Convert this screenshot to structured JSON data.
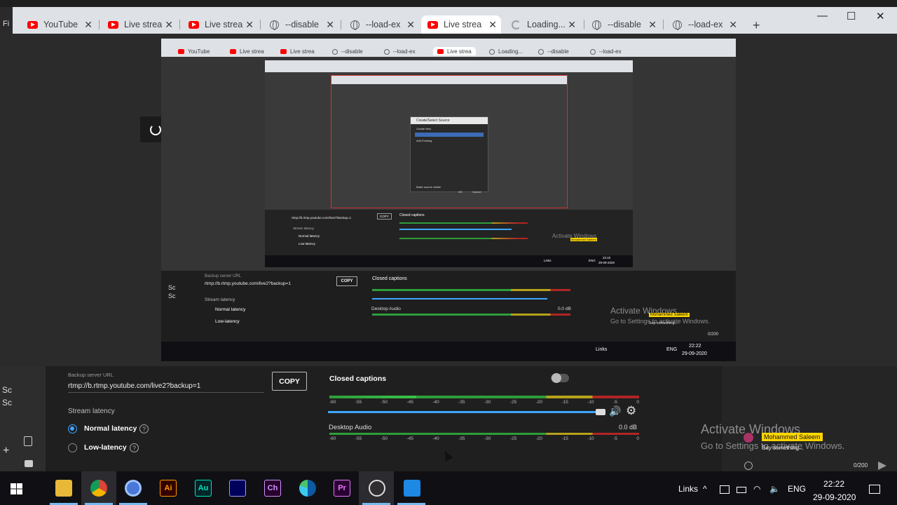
{
  "browser": {
    "side_label": "Fi",
    "tabs": [
      {
        "label": "YouTube",
        "icon": "youtube-icon"
      },
      {
        "label": "Live strea",
        "icon": "youtube-icon"
      },
      {
        "label": "Live strea",
        "icon": "youtube-icon"
      },
      {
        "label": "--disable",
        "icon": "globe-icon"
      },
      {
        "label": "--load-ex",
        "icon": "globe-icon"
      },
      {
        "label": "Live strea",
        "icon": "youtube-icon",
        "active": true
      },
      {
        "label": "Loading...",
        "icon": "loading-spinner-icon"
      },
      {
        "label": "--disable",
        "icon": "globe-icon"
      },
      {
        "label": "--load-ex",
        "icon": "globe-icon"
      }
    ],
    "new_tab": "+",
    "minimize": "—",
    "maximize": "☐",
    "close": "✕"
  },
  "nested": {
    "tabs": [
      "YouTube",
      "Live strea",
      "Live strea",
      "--disable",
      "--load-ex",
      "Live strea",
      "Loading...",
      "--disable",
      "--load-ex"
    ],
    "dialog_title": "Create/Select Source",
    "dialog_items": [
      "Create New",
      "Add Existing"
    ],
    "dialog_checkbox": "Make source visible",
    "dialog_ok": "OK",
    "dialog_cancel": "Cancel",
    "backup_label": "Backup server URL",
    "backup_url": "rtmp://b.rtmp.youtube.com/live2?backup=1",
    "copy": "COPY",
    "closed_captions": "Closed captions",
    "stream_latency": "Stream latency",
    "normal_latency": "Normal latency",
    "low_latency": "Low-latency",
    "desktop_audio": "Desktop Audio",
    "db": "0.0 dB",
    "activate_title": "Activate Windows",
    "activate_sub": "Go to Settings to activate Windows.",
    "chat_name": "Mohammed Saleem",
    "chat_msg": "Say something...",
    "counter": "0/200",
    "links": "Links",
    "lang": "ENG",
    "time": "22:22",
    "date": "29-09-2020",
    "side_sc": [
      "Sc",
      "Sc"
    ]
  },
  "studio": {
    "backup_label": "Backup server URL",
    "backup_url": "rtmp://b.rtmp.youtube.com/live2?backup=1",
    "copy_label": "COPY",
    "closed_captions": "Closed captions",
    "stream_latency": "Stream latency",
    "normal_latency": "Normal latency",
    "low_latency": "Low-latency",
    "desktop_audio": "Desktop Audio",
    "audio_db": "0.0 dB",
    "meter_ticks": [
      "-60",
      "-55",
      "-50",
      "-45",
      "-40",
      "-35",
      "-30",
      "-25",
      "-20",
      "-15",
      "-10",
      "-5",
      "0"
    ],
    "side_sc": [
      "Sc",
      "Sc"
    ],
    "add": "+",
    "captions_enabled": false,
    "selected_latency": "Normal latency"
  },
  "chat": {
    "activate_title": "Activate Windows",
    "activate_sub": "Go to Settings to activate Windows.",
    "author": "Mohammed Saleem",
    "message": "Say something...",
    "counter": "0/200"
  },
  "taskbar": {
    "apps": [
      {
        "name": "file-explorer-icon",
        "label": ""
      },
      {
        "name": "chrome-icon",
        "label": ""
      },
      {
        "name": "chromium-icon",
        "label": ""
      },
      {
        "name": "illustrator-icon",
        "label": "Ai"
      },
      {
        "name": "audition-icon",
        "label": "Au"
      },
      {
        "name": "after-effects-icon",
        "label": ""
      },
      {
        "name": "character-animator-icon",
        "label": "Ch"
      },
      {
        "name": "edge-icon",
        "label": ""
      },
      {
        "name": "premiere-icon",
        "label": "Pr"
      },
      {
        "name": "obs-icon",
        "label": ""
      },
      {
        "name": "camtasia-icon",
        "label": ""
      }
    ],
    "links": "Links",
    "lang": "ENG",
    "time": "22:22",
    "date": "29-09-2020"
  },
  "colors": {
    "accent": "#3ea6ff",
    "youtube_red": "#ff0000",
    "meter_green": "#2e9d3a",
    "meter_yellow": "#b5a21a",
    "meter_red": "#b02525",
    "chat_badge": "#ffd600"
  }
}
